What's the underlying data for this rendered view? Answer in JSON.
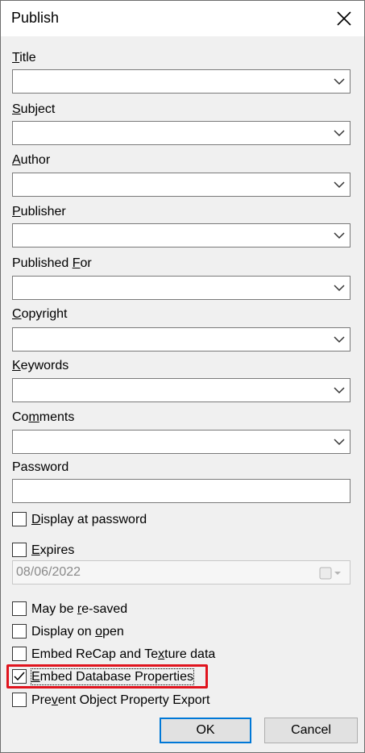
{
  "window": {
    "title": "Publish"
  },
  "fields": [
    {
      "id": "title",
      "label_pre": "",
      "label_u": "T",
      "label_post": "itle",
      "value": ""
    },
    {
      "id": "subject",
      "label_pre": "",
      "label_u": "S",
      "label_post": "ubject",
      "value": ""
    },
    {
      "id": "author",
      "label_pre": "",
      "label_u": "A",
      "label_post": "uthor",
      "value": ""
    },
    {
      "id": "publisher",
      "label_pre": "",
      "label_u": "P",
      "label_post": "ublisher",
      "value": ""
    },
    {
      "id": "published-for",
      "label_pre": "Published ",
      "label_u": "F",
      "label_post": "or",
      "value": ""
    },
    {
      "id": "copyright",
      "label_pre": "",
      "label_u": "C",
      "label_post": "opyright",
      "value": ""
    },
    {
      "id": "keywords",
      "label_pre": "",
      "label_u": "K",
      "label_post": "eywords",
      "value": ""
    },
    {
      "id": "comments",
      "label_pre": "Co",
      "label_u": "m",
      "label_post": "ments",
      "value": ""
    }
  ],
  "password": {
    "label": "Password",
    "value": ""
  },
  "display_at_password": {
    "label_pre": "",
    "label_u": "D",
    "label_post": "isplay at password",
    "checked": false
  },
  "expires": {
    "label_pre": "",
    "label_u": "E",
    "label_post": "xpires",
    "checked": false,
    "date": "08/06/2022"
  },
  "options": [
    {
      "id": "may-be-resaved",
      "label_pre": "May be ",
      "label_u": "r",
      "label_post": "e-saved",
      "checked": false
    },
    {
      "id": "display-on-open",
      "label_pre": "Display on ",
      "label_u": "o",
      "label_post": "pen",
      "checked": false
    },
    {
      "id": "embed-recap",
      "label_pre": "Embed ReCap and Te",
      "label_u": "x",
      "label_post": "ture data",
      "checked": false
    },
    {
      "id": "embed-database",
      "label_pre": "",
      "label_u": "E",
      "label_post": "mbed Database Properties",
      "checked": true
    },
    {
      "id": "prevent-export",
      "label_pre": "Pre",
      "label_u": "v",
      "label_post": "ent Object Property Export",
      "checked": false
    }
  ],
  "buttons": {
    "ok": "OK",
    "cancel": "Cancel"
  },
  "colors": {
    "highlight": "#e0141e",
    "default_button_border": "#0078d7"
  }
}
